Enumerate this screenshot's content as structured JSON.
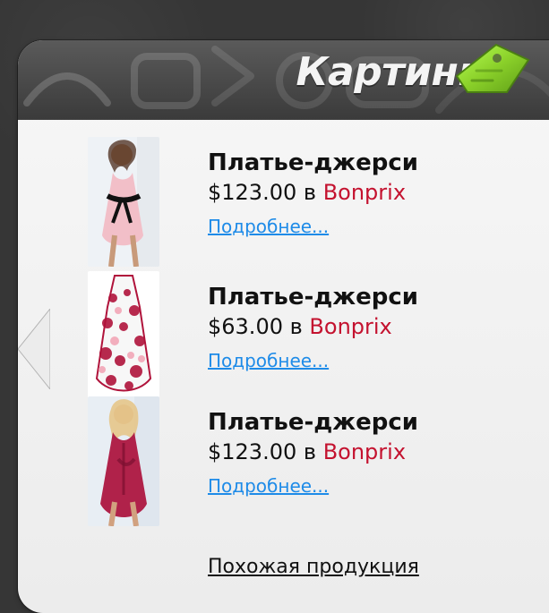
{
  "header": {
    "title": "Картинка",
    "icon": "price-tag-icon"
  },
  "colors": {
    "background": "#363636",
    "card": "#f2f2f2",
    "header": "#4a4a4a",
    "tag_green": "#8bd12a",
    "store_red": "#c4122f",
    "link_blue": "#1e8be8"
  },
  "products": [
    {
      "title": "Платье-джерси",
      "price": "$123.00",
      "in_word": "в",
      "store": "Bonprix",
      "more_label": "Подробнее...",
      "image_name": "dress-thumbnail-1"
    },
    {
      "title": "Платье-джерси",
      "price": "$63.00",
      "in_word": "в",
      "store": "Bonprix",
      "more_label": "Подробнее...",
      "image_name": "dress-thumbnail-2"
    },
    {
      "title": "Платье-джерси",
      "price": "$123.00",
      "in_word": "в",
      "store": "Bonprix",
      "more_label": "Подробнее...",
      "image_name": "dress-thumbnail-3"
    }
  ],
  "footer": {
    "similar_label": "Похожая продукция"
  }
}
